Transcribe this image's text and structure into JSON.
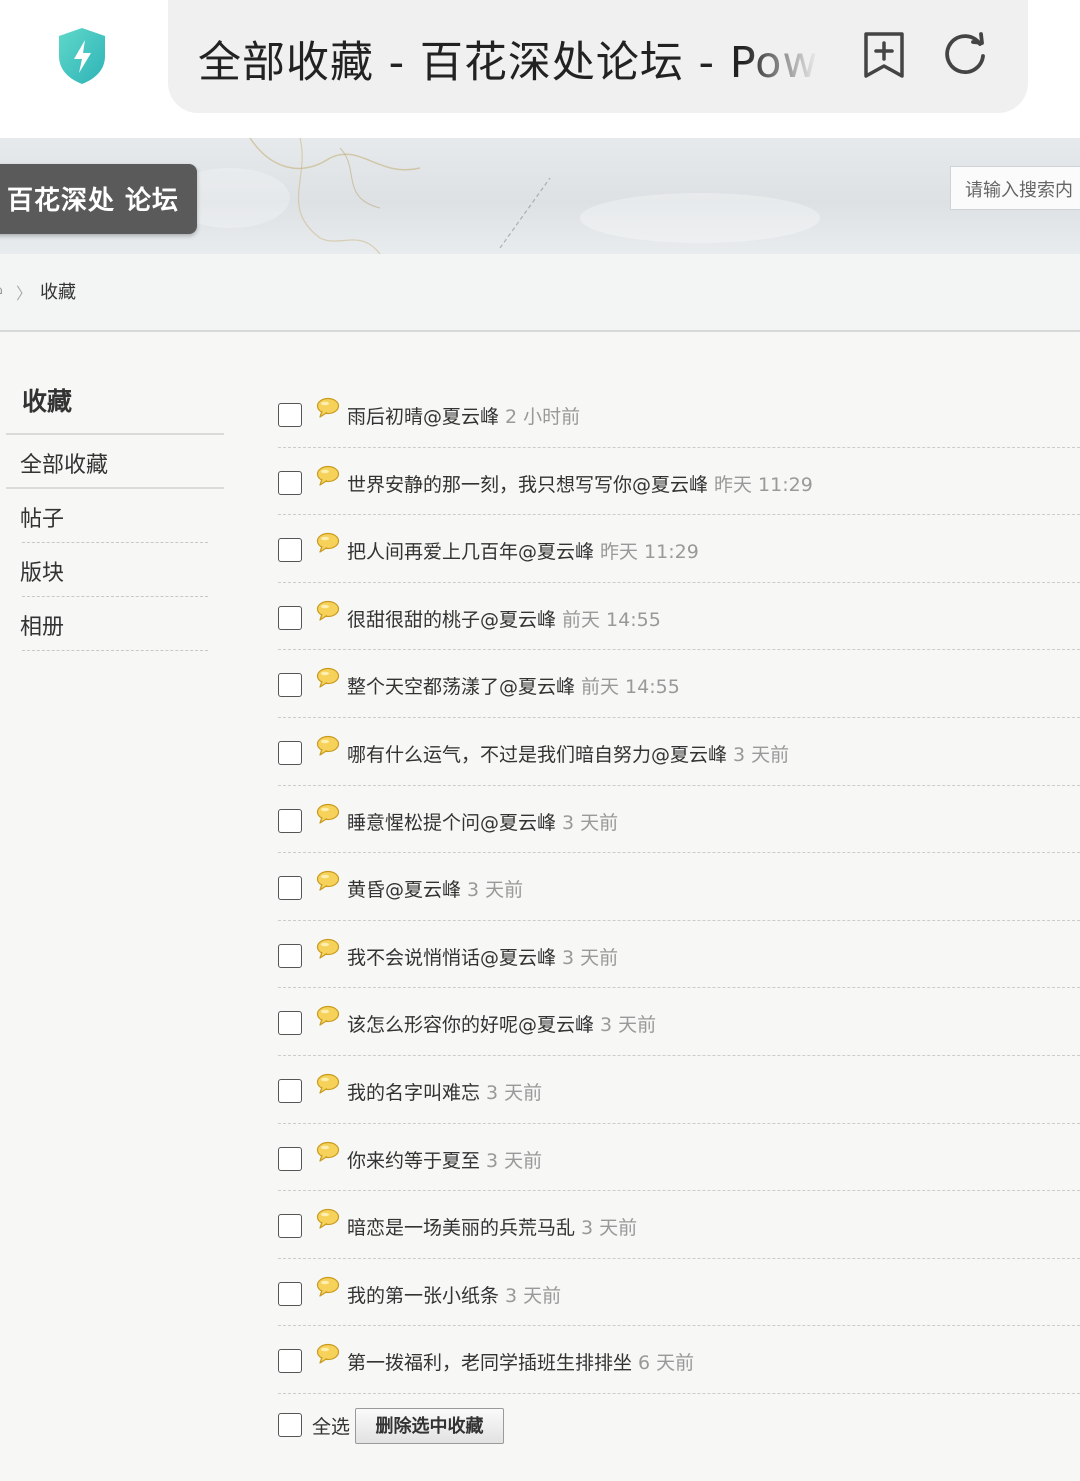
{
  "browser": {
    "url_title": "全部收藏 - 百花深处论坛 - Pow"
  },
  "site": {
    "logo": "百花深处 论坛",
    "search_placeholder": "请输入搜索内"
  },
  "breadcrumb": {
    "home": "⌂",
    "separator": "〉",
    "current": "收藏"
  },
  "sidebar": {
    "title": "收藏",
    "items": [
      {
        "label": "全部收藏"
      },
      {
        "label": "帖子"
      },
      {
        "label": "版块"
      },
      {
        "label": "相册"
      }
    ]
  },
  "favorites": [
    {
      "title": "雨后初晴@夏云峰",
      "time": "2 小时前"
    },
    {
      "title": "世界安静的那一刻，我只想写写你@夏云峰",
      "time": "昨天 11:29"
    },
    {
      "title": "把人间再爱上几百年@夏云峰",
      "time": "昨天 11:29"
    },
    {
      "title": "很甜很甜的桃子@夏云峰",
      "time": "前天 14:55"
    },
    {
      "title": "整个天空都荡漾了@夏云峰",
      "time": "前天 14:55"
    },
    {
      "title": "哪有什么运气，不过是我们暗自努力@夏云峰",
      "time": "3 天前"
    },
    {
      "title": "睡意惺松提个问@夏云峰",
      "time": "3 天前"
    },
    {
      "title": "黄昏@夏云峰",
      "time": "3 天前"
    },
    {
      "title": "我不会说悄悄话@夏云峰",
      "time": "3 天前"
    },
    {
      "title": "该怎么形容你的好呢@夏云峰",
      "time": "3 天前"
    },
    {
      "title": "我的名字叫难忘",
      "time": "3 天前"
    },
    {
      "title": "你来约等于夏至",
      "time": "3 天前"
    },
    {
      "title": "暗恋是一场美丽的兵荒马乱",
      "time": "3 天前"
    },
    {
      "title": "我的第一张小纸条",
      "time": "3 天前"
    },
    {
      "title": "第一拨福利，老同学插班生排排坐",
      "time": "6 天前"
    }
  ],
  "actions": {
    "select_all": "全选",
    "delete_selected": "删除选中收藏"
  },
  "colors": {
    "shield": "#3ec7c0",
    "logo_bg": "#5a5a5a",
    "bubble": "#f2c94c"
  }
}
